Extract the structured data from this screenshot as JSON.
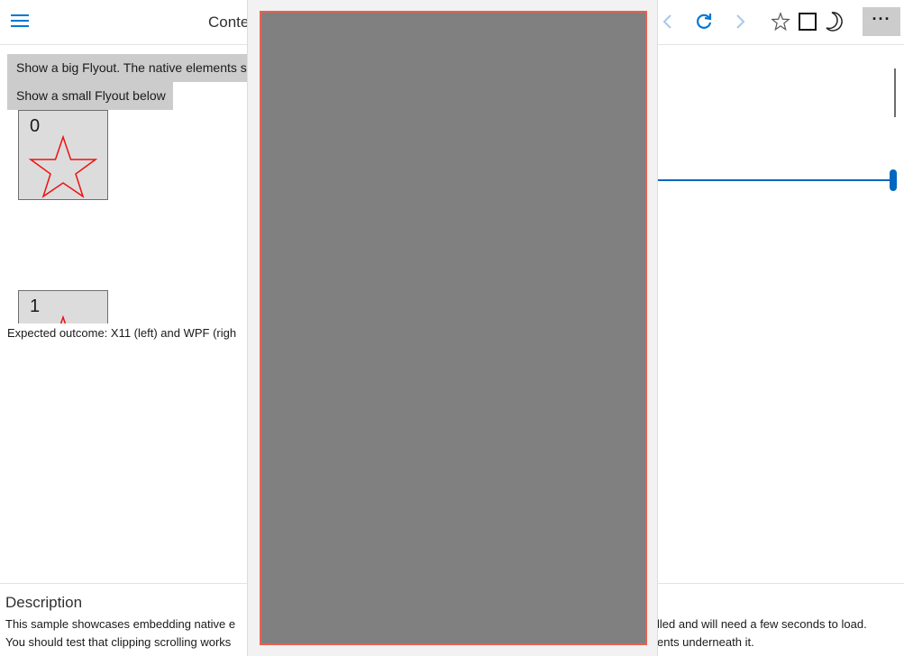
{
  "header": {
    "title": "Conte",
    "more_label": "···",
    "icons": [
      "hamburger-icon",
      "back-icon",
      "refresh-icon",
      "forward-icon",
      "star-icon",
      "square-icon",
      "moon-icon",
      "more-icon"
    ],
    "accent_color": "#0078d4"
  },
  "content": {
    "big_flyout_button": "Show a big Flyout. The native elements sh",
    "small_flyout_button": "Show a small Flyout below",
    "tiles": [
      {
        "label": "0"
      },
      {
        "label": "1"
      }
    ],
    "expected_outcome": "Expected outcome: X11 (left) and WPF (righ",
    "star_color": "#ee1111",
    "slider_value": 1.0
  },
  "description": {
    "title": "Description",
    "line1_left": "This sample showcases embedding native e",
    "line1_right": "lled and will need a few seconds to load.",
    "line2_left": "You should test that clipping scrolling works",
    "line2_right": "ents underneath it."
  },
  "flyout": {
    "background": "#808080",
    "border_color": "#e8604e"
  }
}
